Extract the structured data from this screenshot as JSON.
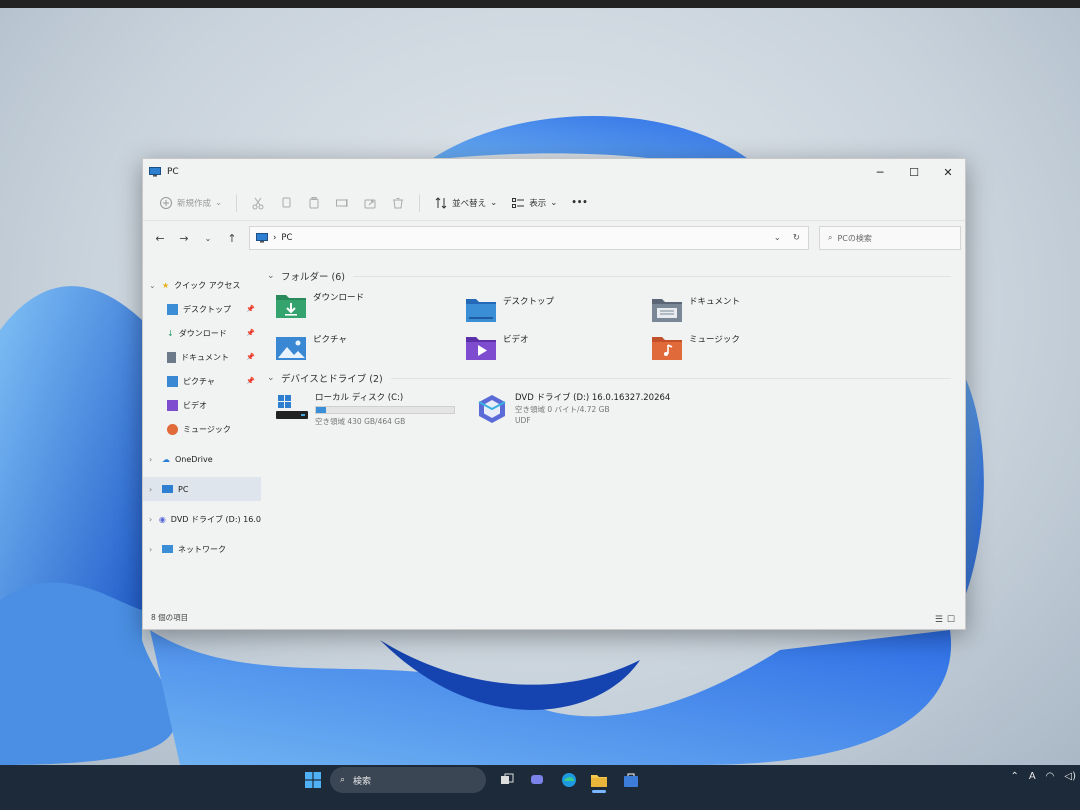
{
  "window": {
    "title": "PC",
    "controls": {
      "minimize": "─",
      "maximize": "☐",
      "close": "✕"
    }
  },
  "toolbar": {
    "new_label": "新規作成",
    "sort_label": "並べ替え",
    "view_label": "表示",
    "more_label": "•••"
  },
  "address": {
    "path": "PC",
    "search_placeholder": "PCの検索"
  },
  "sidebar": {
    "quick_access": "クイック アクセス",
    "items": [
      {
        "label": "デスクトップ",
        "icon": "desktop-icon",
        "color": "#3b8ed6"
      },
      {
        "label": "ダウンロード",
        "icon": "download-icon",
        "color": "#2a9d6c"
      },
      {
        "label": "ドキュメント",
        "icon": "document-icon",
        "color": "#6d7a89"
      },
      {
        "label": "ピクチャ",
        "icon": "picture-icon",
        "color": "#3a88d4"
      },
      {
        "label": "ビデオ",
        "icon": "video-icon",
        "color": "#7d4ccf"
      },
      {
        "label": "ミュージック",
        "icon": "music-icon",
        "color": "#e06a3a"
      }
    ],
    "onedrive": "OneDrive",
    "pc": "PC",
    "dvd": "DVD ドライブ (D:) 16.0",
    "network": "ネットワーク"
  },
  "content": {
    "folders_header": "フォルダー (6)",
    "folders": [
      {
        "label": "ダウンロード",
        "icon": "download-folder-icon"
      },
      {
        "label": "デスクトップ",
        "icon": "desktop-folder-icon"
      },
      {
        "label": "ドキュメント",
        "icon": "documents-folder-icon"
      },
      {
        "label": "ピクチャ",
        "icon": "pictures-folder-icon"
      },
      {
        "label": "ビデオ",
        "icon": "videos-folder-icon"
      },
      {
        "label": "ミュージック",
        "icon": "music-folder-icon"
      }
    ],
    "drives_header": "デバイスとドライブ (2)",
    "drives": [
      {
        "label": "ローカル ディスク (C:)",
        "free": "空き領域 430 GB/464 GB",
        "used_fraction": 0.07
      },
      {
        "label": "DVD ドライブ (D:) 16.0.16327.20264",
        "free": "空き領域 0 バイト/4.72 GB",
        "fs": "UDF"
      }
    ]
  },
  "status": {
    "count": "8 個の項目"
  },
  "taskbar": {
    "search_label": "検索",
    "tray_ime": "A"
  }
}
